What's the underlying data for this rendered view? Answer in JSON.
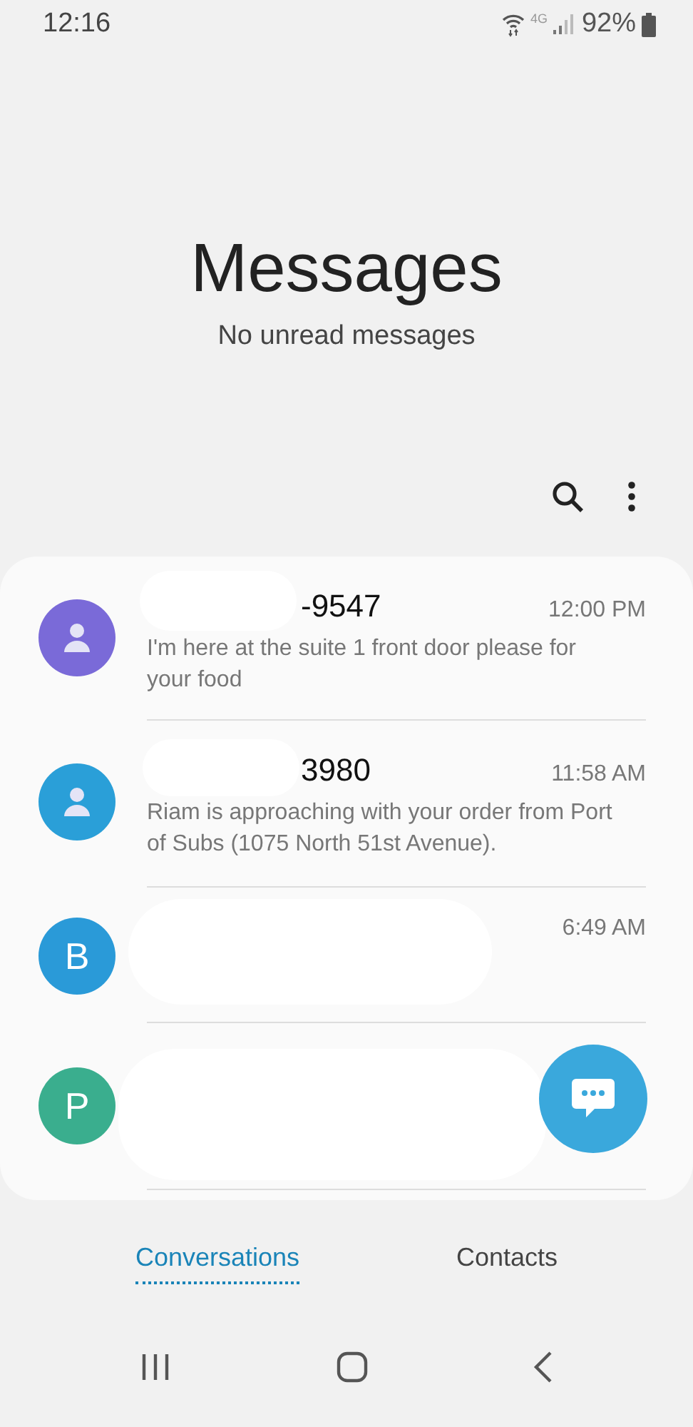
{
  "status_bar": {
    "time": "12:16",
    "network": "4G",
    "battery": "92%"
  },
  "header": {
    "title": "Messages",
    "subtitle": "No unread messages"
  },
  "conversations": [
    {
      "kind": "person",
      "color": "#7a6ad8",
      "name": "-9547",
      "time": "12:00 PM",
      "preview": "I'm here at the suite 1 front door please for your food",
      "redacted": true
    },
    {
      "kind": "person",
      "color": "#2a9fd8",
      "name": "3980",
      "time": "11:58 AM",
      "preview": "Riam is approaching with your order from Port of Subs (1075 North 51st Avenue).",
      "redacted": true
    },
    {
      "kind": "letter",
      "initial": "B",
      "color": "#2a9ad8",
      "time": "6:49 AM",
      "redacted": true
    },
    {
      "kind": "letter",
      "initial": "P",
      "color": "#3aae8e",
      "redacted": true
    }
  ],
  "tabs": [
    {
      "label": "Conversations",
      "selected": true
    },
    {
      "label": "Contacts",
      "selected": false
    }
  ]
}
